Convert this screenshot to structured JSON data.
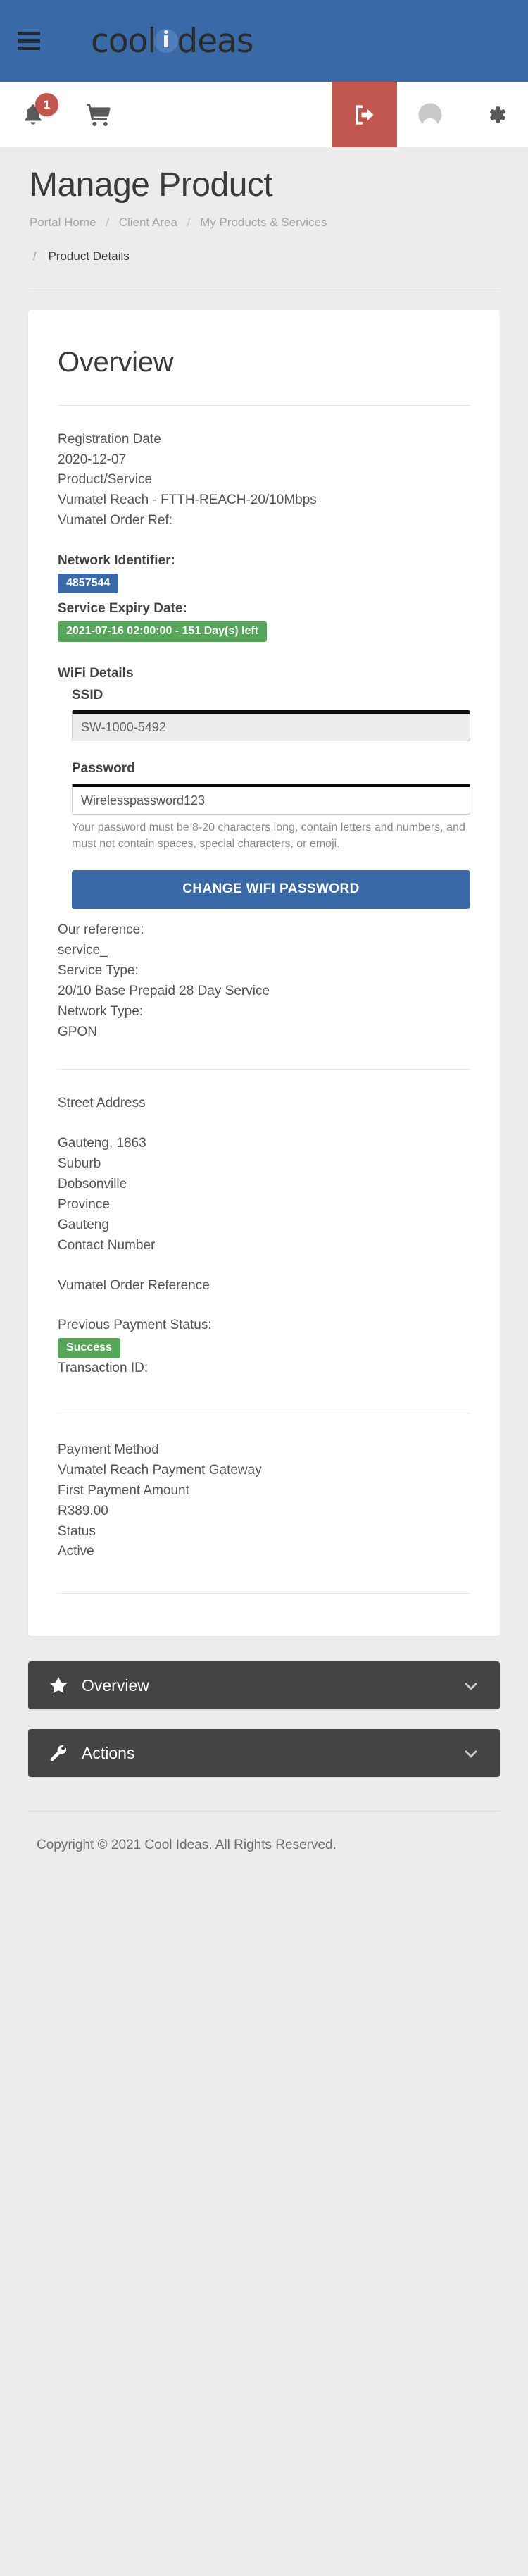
{
  "header": {
    "menu_icon": "hamburger-icon",
    "brand_part1": "cool",
    "brand_part2": "deas",
    "notification_count": "1",
    "icons": [
      "bell-icon",
      "cart-icon",
      "logout-icon",
      "user-icon",
      "gear-icon"
    ]
  },
  "page": {
    "title": "Manage Product",
    "breadcrumb": {
      "item1": "Portal Home",
      "item2": "Client Area",
      "item3": "My Products & Services",
      "sep": "/",
      "current": "Product Details"
    }
  },
  "overview": {
    "heading": "Overview",
    "registration_date_label": "Registration Date",
    "registration_date_value": "2020-12-07",
    "product_service_label": "Product/Service",
    "product_service_value": "Vumatel Reach - FTTH-REACH-20/10Mbps",
    "vumatel_order_ref_label": "Vumatel Order Ref:",
    "network_identifier_label": "Network Identifier:",
    "network_identifier_value": "4857544",
    "service_expiry_label": "Service Expiry Date:",
    "service_expiry_value": "2021-07-16 02:00:00 - 151 Day(s) left",
    "wifi_details_heading": "WiFi Details",
    "ssid_label": "SSID",
    "ssid_value": "SW-1000-5492",
    "password_label": "Password",
    "password_value": "Wirelesspassword123",
    "password_help": "Your password must be 8-20 characters long, contain letters and numbers, and must not contain spaces, special characters, or emoji.",
    "change_wifi_password_button": "CHANGE WIFI PASSWORD",
    "our_reference_label": "Our reference:",
    "our_reference_value": "service_",
    "service_type_label": "Service Type:",
    "service_type_value": "20/10 Base Prepaid 28 Day Service",
    "network_type_label": "Network Type:",
    "network_type_value": "GPON",
    "street_address_label": "Street Address",
    "address_line1": "Gauteng, 1863",
    "suburb_label": "Suburb",
    "suburb_value": "Dobsonville",
    "province_label": "Province",
    "province_value": "Gauteng",
    "contact_number_label": "Contact Number",
    "vumatel_order_reference_label": "Vumatel Order Reference",
    "previous_payment_status_label": "Previous Payment Status:",
    "previous_payment_status_value": "Success",
    "transaction_id_label": "Transaction ID:",
    "payment_method_label": "Payment Method",
    "payment_method_value": "Vumatel Reach Payment Gateway",
    "first_payment_amount_label": "First Payment Amount",
    "first_payment_amount_value": "R389.00",
    "status_label": "Status",
    "status_value": "Active"
  },
  "accordions": [
    {
      "label": "Overview",
      "icon": "star-icon",
      "chevron": "chevron-down-icon"
    },
    {
      "label": "Actions",
      "icon": "wrench-icon",
      "chevron": "chevron-down-icon"
    }
  ],
  "footer": {
    "copyright": "Copyright © 2021 Cool Ideas. All Rights Reserved."
  },
  "colors": {
    "brand_blue": "#3a69a8",
    "logout_red": "#c0574f",
    "success_green": "#56a65a",
    "accordion_dark": "#444444",
    "page_bg": "#ececec"
  }
}
